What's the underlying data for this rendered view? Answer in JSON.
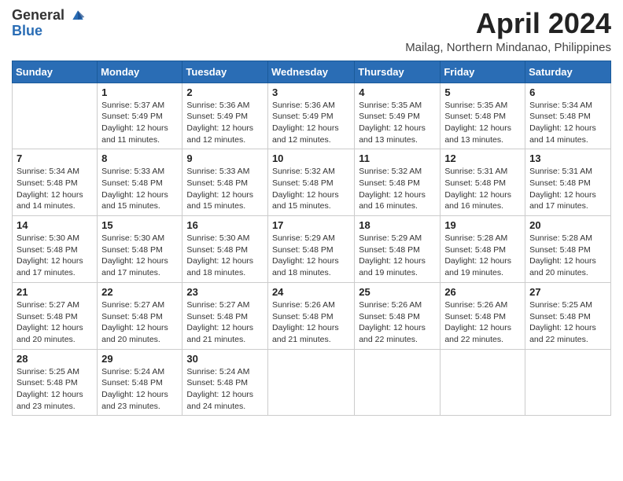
{
  "header": {
    "logo_general": "General",
    "logo_blue": "Blue",
    "month_title": "April 2024",
    "location": "Mailag, Northern Mindanao, Philippines"
  },
  "days_of_week": [
    "Sunday",
    "Monday",
    "Tuesday",
    "Wednesday",
    "Thursday",
    "Friday",
    "Saturday"
  ],
  "weeks": [
    [
      {
        "day": "",
        "sunrise": "",
        "sunset": "",
        "daylight": ""
      },
      {
        "day": "1",
        "sunrise": "Sunrise: 5:37 AM",
        "sunset": "Sunset: 5:49 PM",
        "daylight": "Daylight: 12 hours and 11 minutes."
      },
      {
        "day": "2",
        "sunrise": "Sunrise: 5:36 AM",
        "sunset": "Sunset: 5:49 PM",
        "daylight": "Daylight: 12 hours and 12 minutes."
      },
      {
        "day": "3",
        "sunrise": "Sunrise: 5:36 AM",
        "sunset": "Sunset: 5:49 PM",
        "daylight": "Daylight: 12 hours and 12 minutes."
      },
      {
        "day": "4",
        "sunrise": "Sunrise: 5:35 AM",
        "sunset": "Sunset: 5:49 PM",
        "daylight": "Daylight: 12 hours and 13 minutes."
      },
      {
        "day": "5",
        "sunrise": "Sunrise: 5:35 AM",
        "sunset": "Sunset: 5:48 PM",
        "daylight": "Daylight: 12 hours and 13 minutes."
      },
      {
        "day": "6",
        "sunrise": "Sunrise: 5:34 AM",
        "sunset": "Sunset: 5:48 PM",
        "daylight": "Daylight: 12 hours and 14 minutes."
      }
    ],
    [
      {
        "day": "7",
        "sunrise": "Sunrise: 5:34 AM",
        "sunset": "Sunset: 5:48 PM",
        "daylight": "Daylight: 12 hours and 14 minutes."
      },
      {
        "day": "8",
        "sunrise": "Sunrise: 5:33 AM",
        "sunset": "Sunset: 5:48 PM",
        "daylight": "Daylight: 12 hours and 15 minutes."
      },
      {
        "day": "9",
        "sunrise": "Sunrise: 5:33 AM",
        "sunset": "Sunset: 5:48 PM",
        "daylight": "Daylight: 12 hours and 15 minutes."
      },
      {
        "day": "10",
        "sunrise": "Sunrise: 5:32 AM",
        "sunset": "Sunset: 5:48 PM",
        "daylight": "Daylight: 12 hours and 15 minutes."
      },
      {
        "day": "11",
        "sunrise": "Sunrise: 5:32 AM",
        "sunset": "Sunset: 5:48 PM",
        "daylight": "Daylight: 12 hours and 16 minutes."
      },
      {
        "day": "12",
        "sunrise": "Sunrise: 5:31 AM",
        "sunset": "Sunset: 5:48 PM",
        "daylight": "Daylight: 12 hours and 16 minutes."
      },
      {
        "day": "13",
        "sunrise": "Sunrise: 5:31 AM",
        "sunset": "Sunset: 5:48 PM",
        "daylight": "Daylight: 12 hours and 17 minutes."
      }
    ],
    [
      {
        "day": "14",
        "sunrise": "Sunrise: 5:30 AM",
        "sunset": "Sunset: 5:48 PM",
        "daylight": "Daylight: 12 hours and 17 minutes."
      },
      {
        "day": "15",
        "sunrise": "Sunrise: 5:30 AM",
        "sunset": "Sunset: 5:48 PM",
        "daylight": "Daylight: 12 hours and 17 minutes."
      },
      {
        "day": "16",
        "sunrise": "Sunrise: 5:30 AM",
        "sunset": "Sunset: 5:48 PM",
        "daylight": "Daylight: 12 hours and 18 minutes."
      },
      {
        "day": "17",
        "sunrise": "Sunrise: 5:29 AM",
        "sunset": "Sunset: 5:48 PM",
        "daylight": "Daylight: 12 hours and 18 minutes."
      },
      {
        "day": "18",
        "sunrise": "Sunrise: 5:29 AM",
        "sunset": "Sunset: 5:48 PM",
        "daylight": "Daylight: 12 hours and 19 minutes."
      },
      {
        "day": "19",
        "sunrise": "Sunrise: 5:28 AM",
        "sunset": "Sunset: 5:48 PM",
        "daylight": "Daylight: 12 hours and 19 minutes."
      },
      {
        "day": "20",
        "sunrise": "Sunrise: 5:28 AM",
        "sunset": "Sunset: 5:48 PM",
        "daylight": "Daylight: 12 hours and 20 minutes."
      }
    ],
    [
      {
        "day": "21",
        "sunrise": "Sunrise: 5:27 AM",
        "sunset": "Sunset: 5:48 PM",
        "daylight": "Daylight: 12 hours and 20 minutes."
      },
      {
        "day": "22",
        "sunrise": "Sunrise: 5:27 AM",
        "sunset": "Sunset: 5:48 PM",
        "daylight": "Daylight: 12 hours and 20 minutes."
      },
      {
        "day": "23",
        "sunrise": "Sunrise: 5:27 AM",
        "sunset": "Sunset: 5:48 PM",
        "daylight": "Daylight: 12 hours and 21 minutes."
      },
      {
        "day": "24",
        "sunrise": "Sunrise: 5:26 AM",
        "sunset": "Sunset: 5:48 PM",
        "daylight": "Daylight: 12 hours and 21 minutes."
      },
      {
        "day": "25",
        "sunrise": "Sunrise: 5:26 AM",
        "sunset": "Sunset: 5:48 PM",
        "daylight": "Daylight: 12 hours and 22 minutes."
      },
      {
        "day": "26",
        "sunrise": "Sunrise: 5:26 AM",
        "sunset": "Sunset: 5:48 PM",
        "daylight": "Daylight: 12 hours and 22 minutes."
      },
      {
        "day": "27",
        "sunrise": "Sunrise: 5:25 AM",
        "sunset": "Sunset: 5:48 PM",
        "daylight": "Daylight: 12 hours and 22 minutes."
      }
    ],
    [
      {
        "day": "28",
        "sunrise": "Sunrise: 5:25 AM",
        "sunset": "Sunset: 5:48 PM",
        "daylight": "Daylight: 12 hours and 23 minutes."
      },
      {
        "day": "29",
        "sunrise": "Sunrise: 5:24 AM",
        "sunset": "Sunset: 5:48 PM",
        "daylight": "Daylight: 12 hours and 23 minutes."
      },
      {
        "day": "30",
        "sunrise": "Sunrise: 5:24 AM",
        "sunset": "Sunset: 5:48 PM",
        "daylight": "Daylight: 12 hours and 24 minutes."
      },
      {
        "day": "",
        "sunrise": "",
        "sunset": "",
        "daylight": ""
      },
      {
        "day": "",
        "sunrise": "",
        "sunset": "",
        "daylight": ""
      },
      {
        "day": "",
        "sunrise": "",
        "sunset": "",
        "daylight": ""
      },
      {
        "day": "",
        "sunrise": "",
        "sunset": "",
        "daylight": ""
      }
    ]
  ]
}
